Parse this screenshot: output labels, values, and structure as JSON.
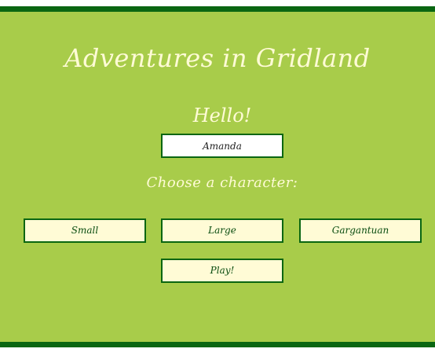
{
  "game": {
    "title": "Adventures in Gridland",
    "greeting": "Hello!",
    "player_name": "Amanda",
    "choose_prompt": "Choose a character:",
    "characters": [
      {
        "label": "Small"
      },
      {
        "label": "Large"
      },
      {
        "label": "Gargantuan"
      }
    ],
    "play_label": "Play!"
  },
  "colors": {
    "background": "#a8cc4a",
    "border_bar": "#0a6612",
    "heading_text": "#fffbd6",
    "button_fill": "#fffbd6"
  }
}
